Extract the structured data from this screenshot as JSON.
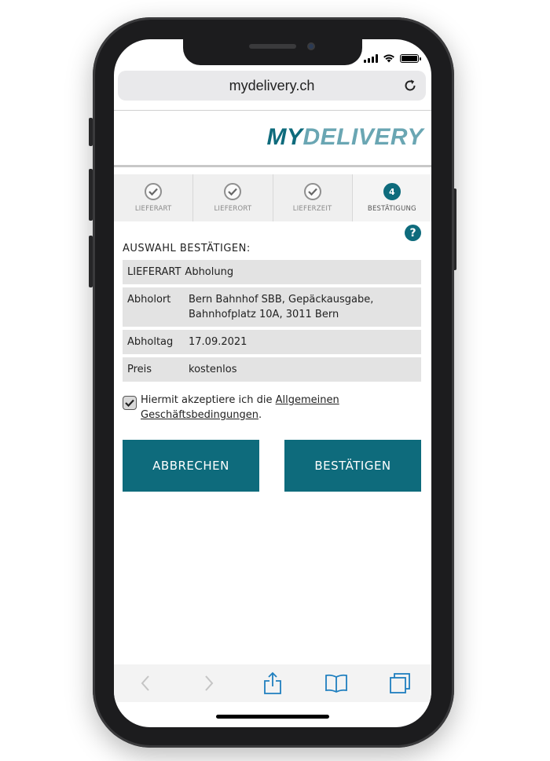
{
  "browser": {
    "url": "mydelivery.ch"
  },
  "brand": {
    "logo_part1": "MY",
    "logo_part2": "DELIVERY",
    "primary_color": "#0e6b7c",
    "secondary_color": "#6aa6b3"
  },
  "stepper": {
    "steps": [
      {
        "label": "LIEFERART",
        "state": "done",
        "icon": "check-icon"
      },
      {
        "label": "LIEFERORT",
        "state": "done",
        "icon": "check-icon"
      },
      {
        "label": "LIEFERZEIT",
        "state": "done",
        "icon": "check-icon"
      },
      {
        "label": "BESTÄTIGUNG",
        "state": "active",
        "number": "4"
      }
    ]
  },
  "help": {
    "label": "?"
  },
  "confirm": {
    "title": "AUSWAHL BESTÄTIGEN:",
    "rows": [
      {
        "key": "LIEFERART",
        "value": "Abholung"
      },
      {
        "key": "Abholort",
        "value": "Bern Bahnhof SBB, Gepäckausgabe, Bahnhofplatz 10A, 3011 Bern"
      },
      {
        "key": "Abholtag",
        "value": "17.09.2021"
      },
      {
        "key": "Preis",
        "value": "kostenlos"
      }
    ]
  },
  "terms": {
    "checked": true,
    "text_before": "Hiermit akzeptiere ich die ",
    "link_text": "Allgemeinen Geschäftsbedingungen",
    "text_after": "."
  },
  "buttons": {
    "cancel": "ABBRECHEN",
    "confirm": "BESTÄTIGEN"
  },
  "toolbar": {
    "icons": [
      "back-icon",
      "forward-icon",
      "share-icon",
      "bookmarks-icon",
      "tabs-icon"
    ]
  }
}
